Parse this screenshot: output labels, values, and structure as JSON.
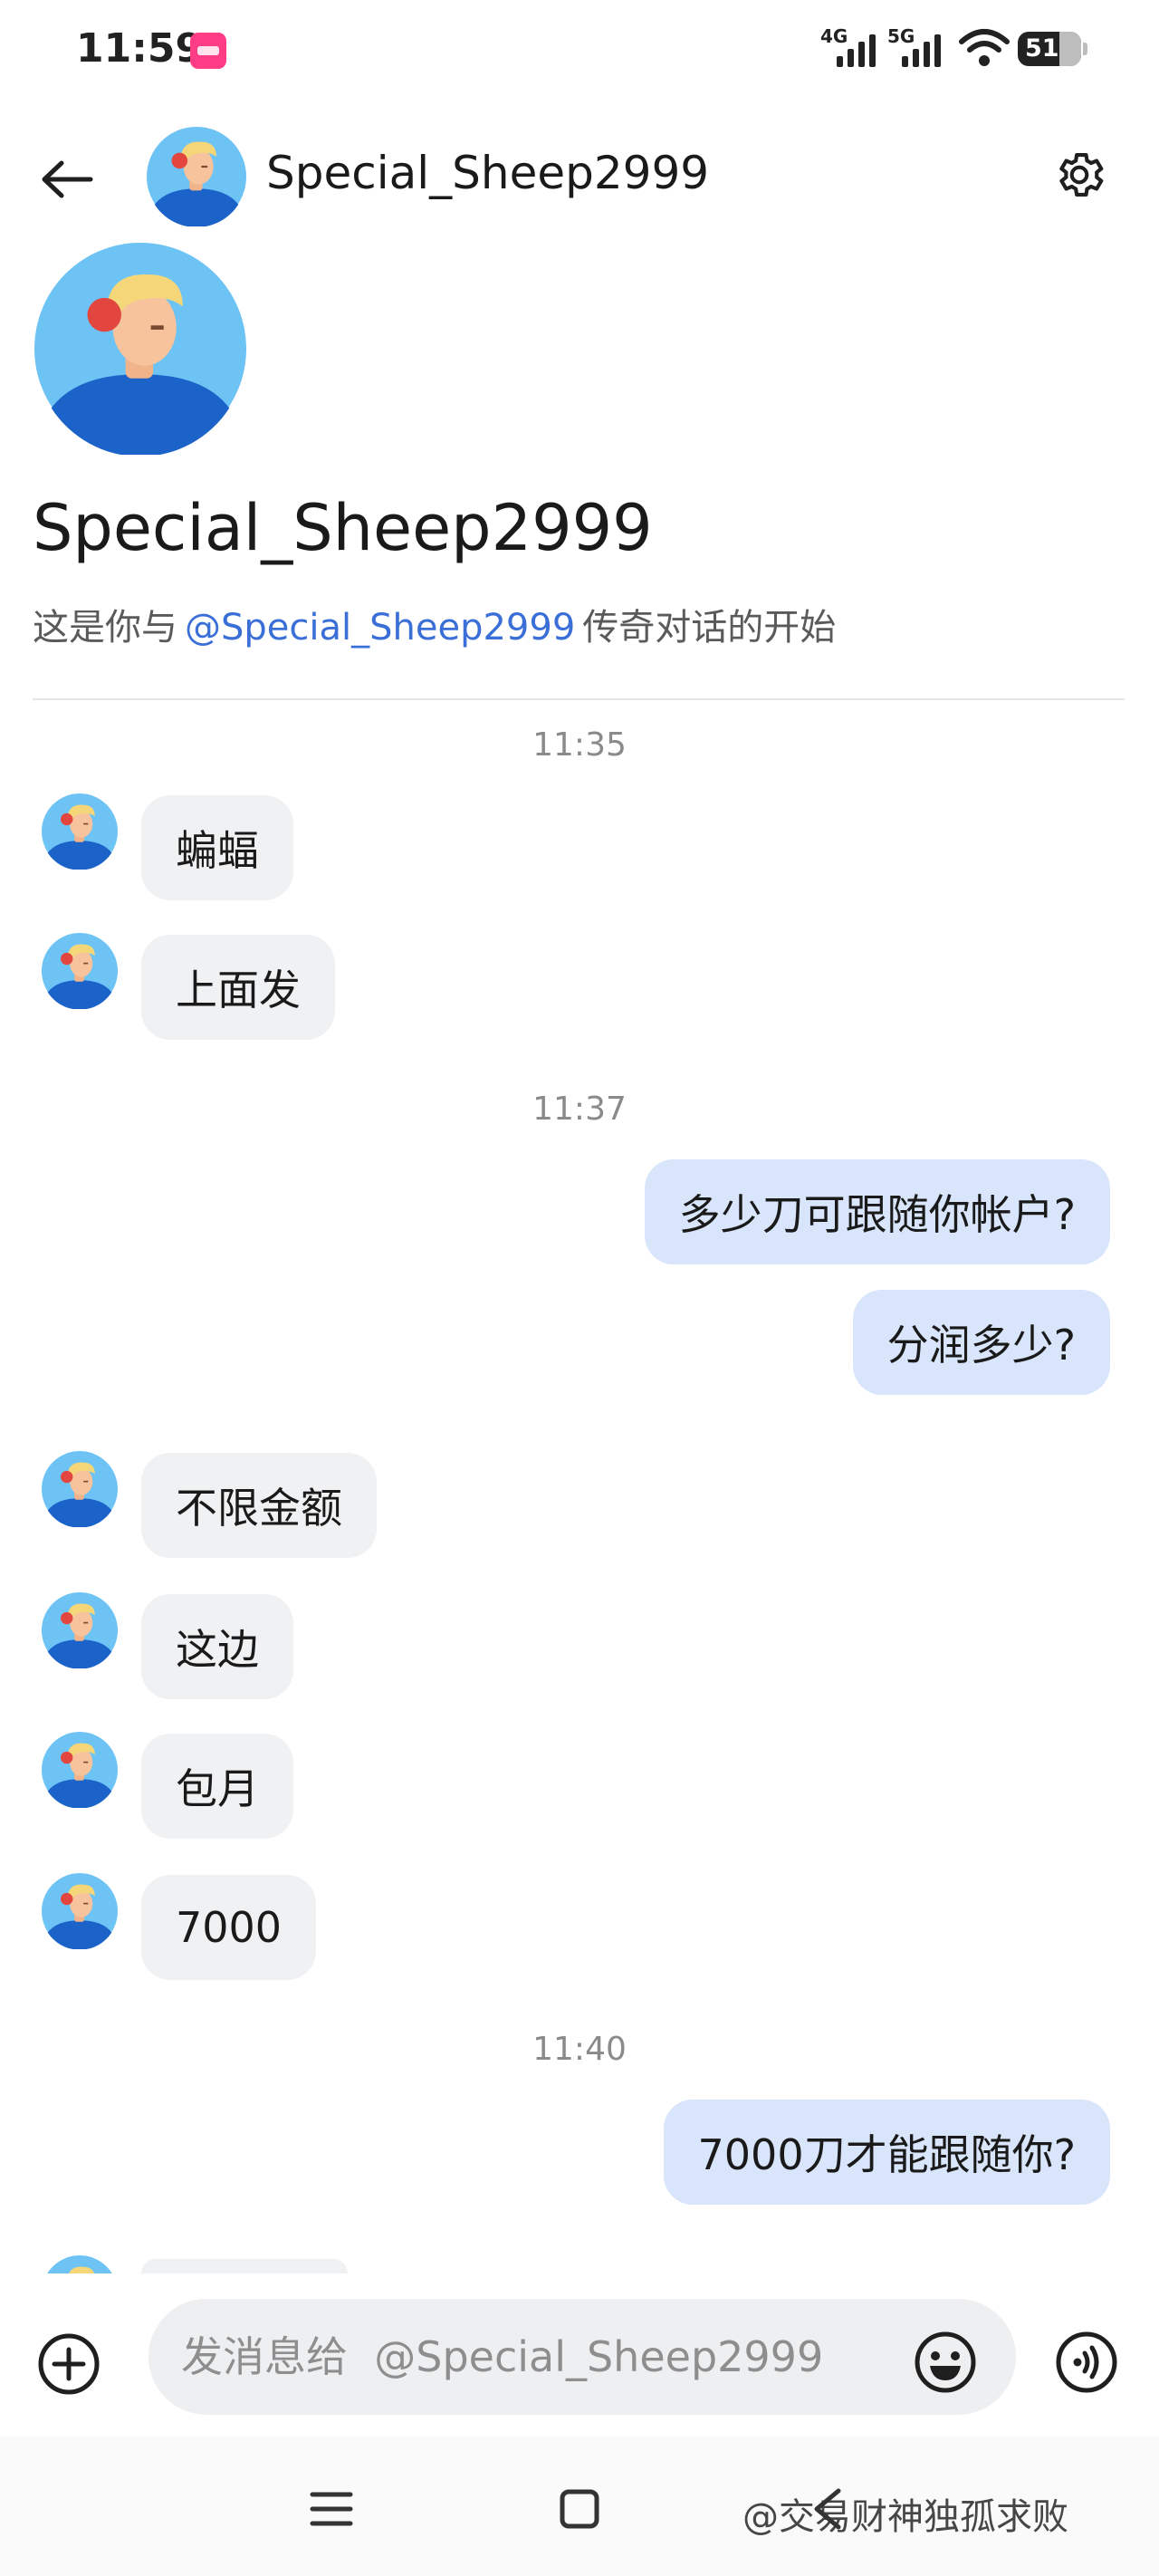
{
  "status_bar": {
    "time": "11:59",
    "network_1": "4G",
    "network_2": "5G",
    "battery": "51"
  },
  "header": {
    "contact_name": "Special_Sheep2999",
    "back_icon": "arrow-left-icon",
    "settings_icon": "gear-icon"
  },
  "profile": {
    "name": "Special_Sheep2999",
    "intro_before": "这是你与",
    "intro_mention": "@Special_Sheep2999",
    "intro_after": "传奇对话的开始"
  },
  "messages": {
    "time_1": "11:35",
    "m1": "蝙蝠",
    "m2": "上面发",
    "time_2": "11:37",
    "m3": "多少刀可跟随你帐户?",
    "m4": "分润多少?",
    "m5": "不限金额",
    "m6": "这边",
    "m7": "包月",
    "m8": "7000",
    "time_3": "11:40",
    "m9": "7000刀才能跟随你?"
  },
  "composer": {
    "placeholder": "发消息给  @Special_Sheep2999",
    "add_icon": "plus-circle-icon",
    "emoji_icon": "smiley-icon",
    "voice_icon": "voice-icon"
  },
  "nav": {
    "watermark": "@交易财神独孤求败"
  },
  "colors": {
    "incoming_bubble": "#f0f1f3",
    "outgoing_bubble": "#d8e5fb",
    "mention": "#3a6fd8",
    "avatar_bg": "#6ec3f5",
    "avatar_shirt": "#1c63c9"
  }
}
